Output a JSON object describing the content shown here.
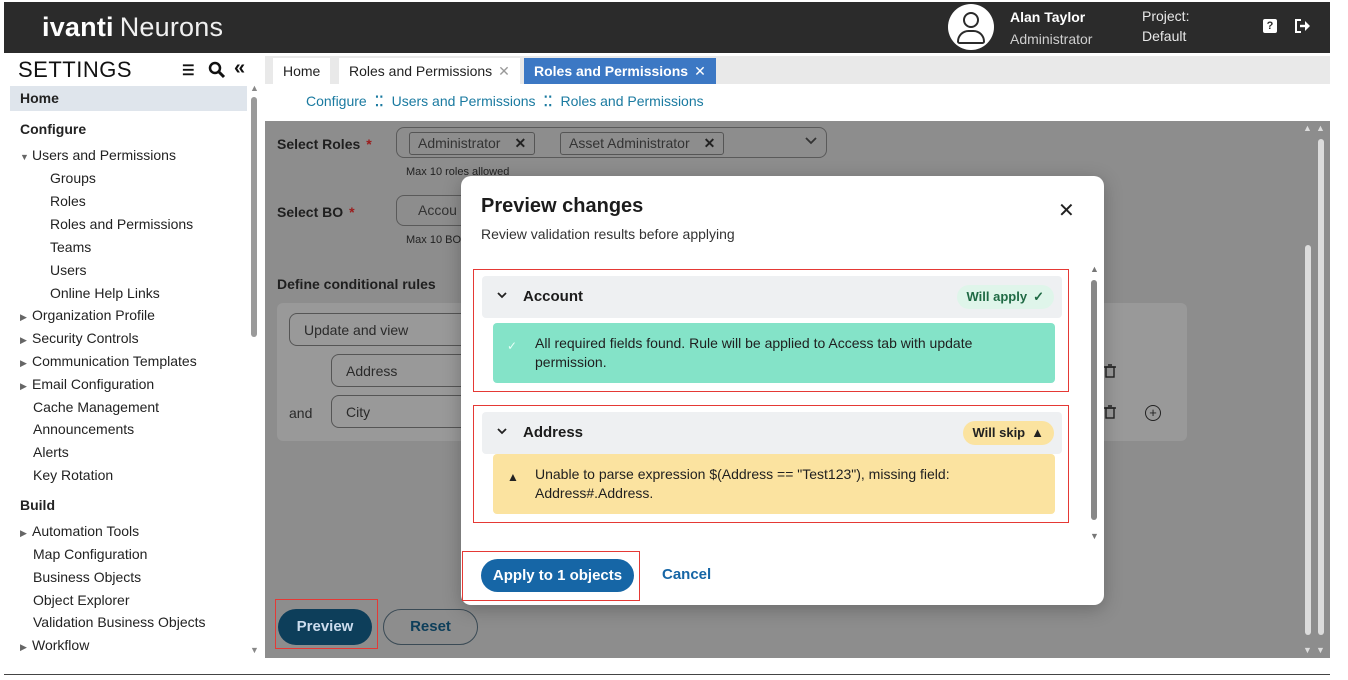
{
  "header": {
    "logo_bold": "ivanti",
    "logo_light": "Neurons",
    "user_name": "Alan Taylor",
    "user_role": "Administrator",
    "project_label": "Project:",
    "project_value": "Default",
    "help_icon": "?"
  },
  "sidebar": {
    "title": "SETTINGS",
    "home": "Home",
    "sections": {
      "configure": "Configure",
      "build": "Build"
    },
    "items": [
      {
        "label": "Users and Permissions",
        "caret": "▼"
      },
      {
        "label": "Groups"
      },
      {
        "label": "Roles"
      },
      {
        "label": "Roles and Permissions"
      },
      {
        "label": "Teams"
      },
      {
        "label": "Users"
      },
      {
        "label": "Online Help Links"
      },
      {
        "label": "Organization Profile",
        "caret": "▶"
      },
      {
        "label": "Security Controls",
        "caret": "▶"
      },
      {
        "label": "Communication Templates",
        "caret": "▶"
      },
      {
        "label": "Email Configuration",
        "caret": "▶"
      },
      {
        "label": "Cache Management"
      },
      {
        "label": "Announcements"
      },
      {
        "label": "Alerts"
      },
      {
        "label": "Key Rotation"
      },
      {
        "label": "Automation Tools",
        "caret": "▶"
      },
      {
        "label": "Map Configuration"
      },
      {
        "label": "Business Objects"
      },
      {
        "label": "Object Explorer"
      },
      {
        "label": "Validation Business Objects"
      },
      {
        "label": "Workflow",
        "caret": "▶"
      }
    ]
  },
  "tabs": [
    {
      "label": "Home"
    },
    {
      "label": "Roles and Permissions",
      "close": "✕"
    },
    {
      "label": "Roles and Permissions",
      "close": "✕"
    }
  ],
  "breadcrumb": [
    "Configure",
    "Users and Permissions",
    "Roles and Permissions"
  ],
  "breadcrumb_sep": "⁚⁚",
  "form": {
    "select_roles_label": "Select Roles",
    "required_mark": "*",
    "roles": [
      "Administrator",
      "Asset Administrator"
    ],
    "chip_remove": "✕",
    "roles_hint": "Max 10 roles allowed",
    "select_bo_label": "Select BO",
    "bo_value": "Accou",
    "bo_hint": "Max 10 BO",
    "rules_label": "Define conditional rules",
    "rule_action": "Update and view",
    "rule_field_1": "Address",
    "and_label": "and",
    "rule_field_2": "City",
    "preview_button": "Preview",
    "reset_button": "Reset"
  },
  "modal": {
    "title": "Preview changes",
    "subtitle": "Review validation results before applying",
    "close": "✕",
    "groups": [
      {
        "title": "Account",
        "badge": "Will apply",
        "badge_icon": "✓",
        "message": "All required fields found. Rule will be applied to Access tab with update permission.",
        "message_icon": "✓",
        "status": "ok"
      },
      {
        "title": "Address",
        "badge": "Will skip",
        "badge_icon": "▲",
        "message": "Unable to parse expression $(Address == \"Test123\"), missing field: Address#.Address.",
        "message_icon": "▲",
        "status": "warn"
      }
    ],
    "apply_button": "Apply to 1 objects",
    "cancel_button": "Cancel"
  },
  "colors": {
    "topbar": "#2b2b2b",
    "active_tab": "#3c78c4",
    "link": "#1a7aa0",
    "primary_button": "#1666a6",
    "success_bg": "#84e3c8",
    "warning_bg": "#fbe3a0",
    "highlight_border": "#e53935"
  }
}
